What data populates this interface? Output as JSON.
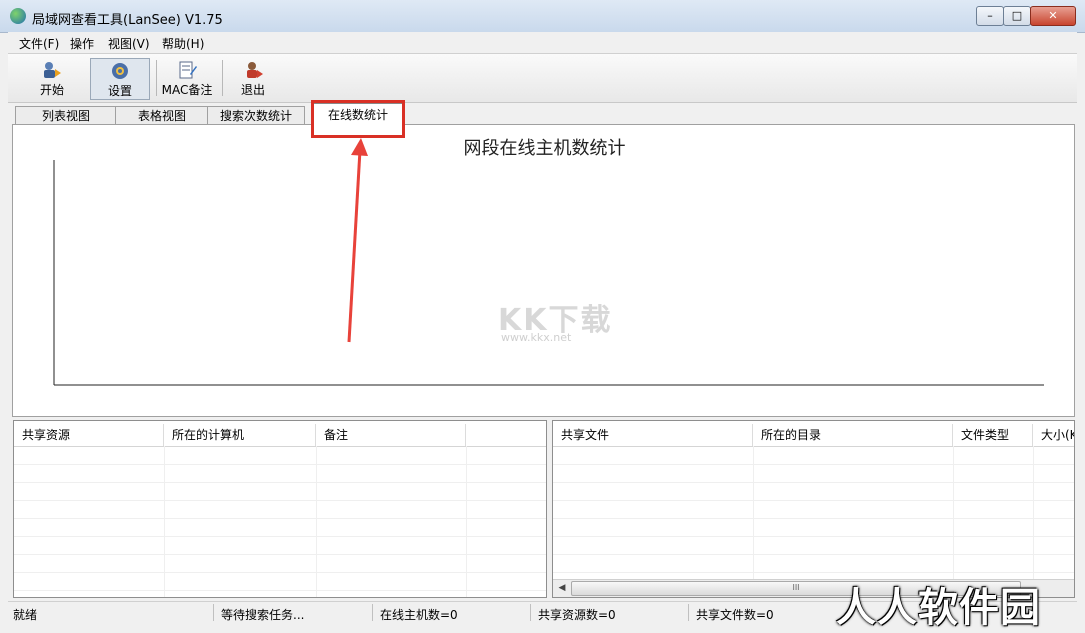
{
  "window": {
    "title": "局域网查看工具(LanSee) V1.75",
    "controls": {
      "minimize": "–",
      "maximize": "□",
      "close": "✕"
    }
  },
  "menu": [
    "文件(F)",
    "操作",
    "视图(V)",
    "帮助(H)"
  ],
  "toolbar": {
    "start_label": "开始",
    "settings_label": "设置",
    "mac_label": "MAC备注",
    "exit_label": "退出"
  },
  "tabs": [
    "列表视图",
    "表格视图",
    "搜索次数统计",
    "在线数统计"
  ],
  "active_tab": "在线数统计",
  "chart_data": {
    "type": "bar",
    "title": "网段在线主机数统计",
    "categories": [],
    "values": []
  },
  "watermark": {
    "logo": "KK下载",
    "url": "www.kkx.net",
    "corner": "人人软件园"
  },
  "left_table": {
    "columns": [
      "共享资源",
      "所在的计算机",
      "备注"
    ],
    "rows": []
  },
  "right_table": {
    "columns": [
      "共享文件",
      "所在的目录",
      "文件类型",
      "大小(K"
    ],
    "rows": [],
    "scroll_grip": "III"
  },
  "status": {
    "state": "就绪",
    "task": "等待搜索任务...",
    "online_hosts": "在线主机数=0",
    "shared_resources": "共享资源数=0",
    "shared_files": "共享文件数=0"
  },
  "colors": {
    "highlight": "#d93025",
    "arrow": "#e8423a"
  }
}
